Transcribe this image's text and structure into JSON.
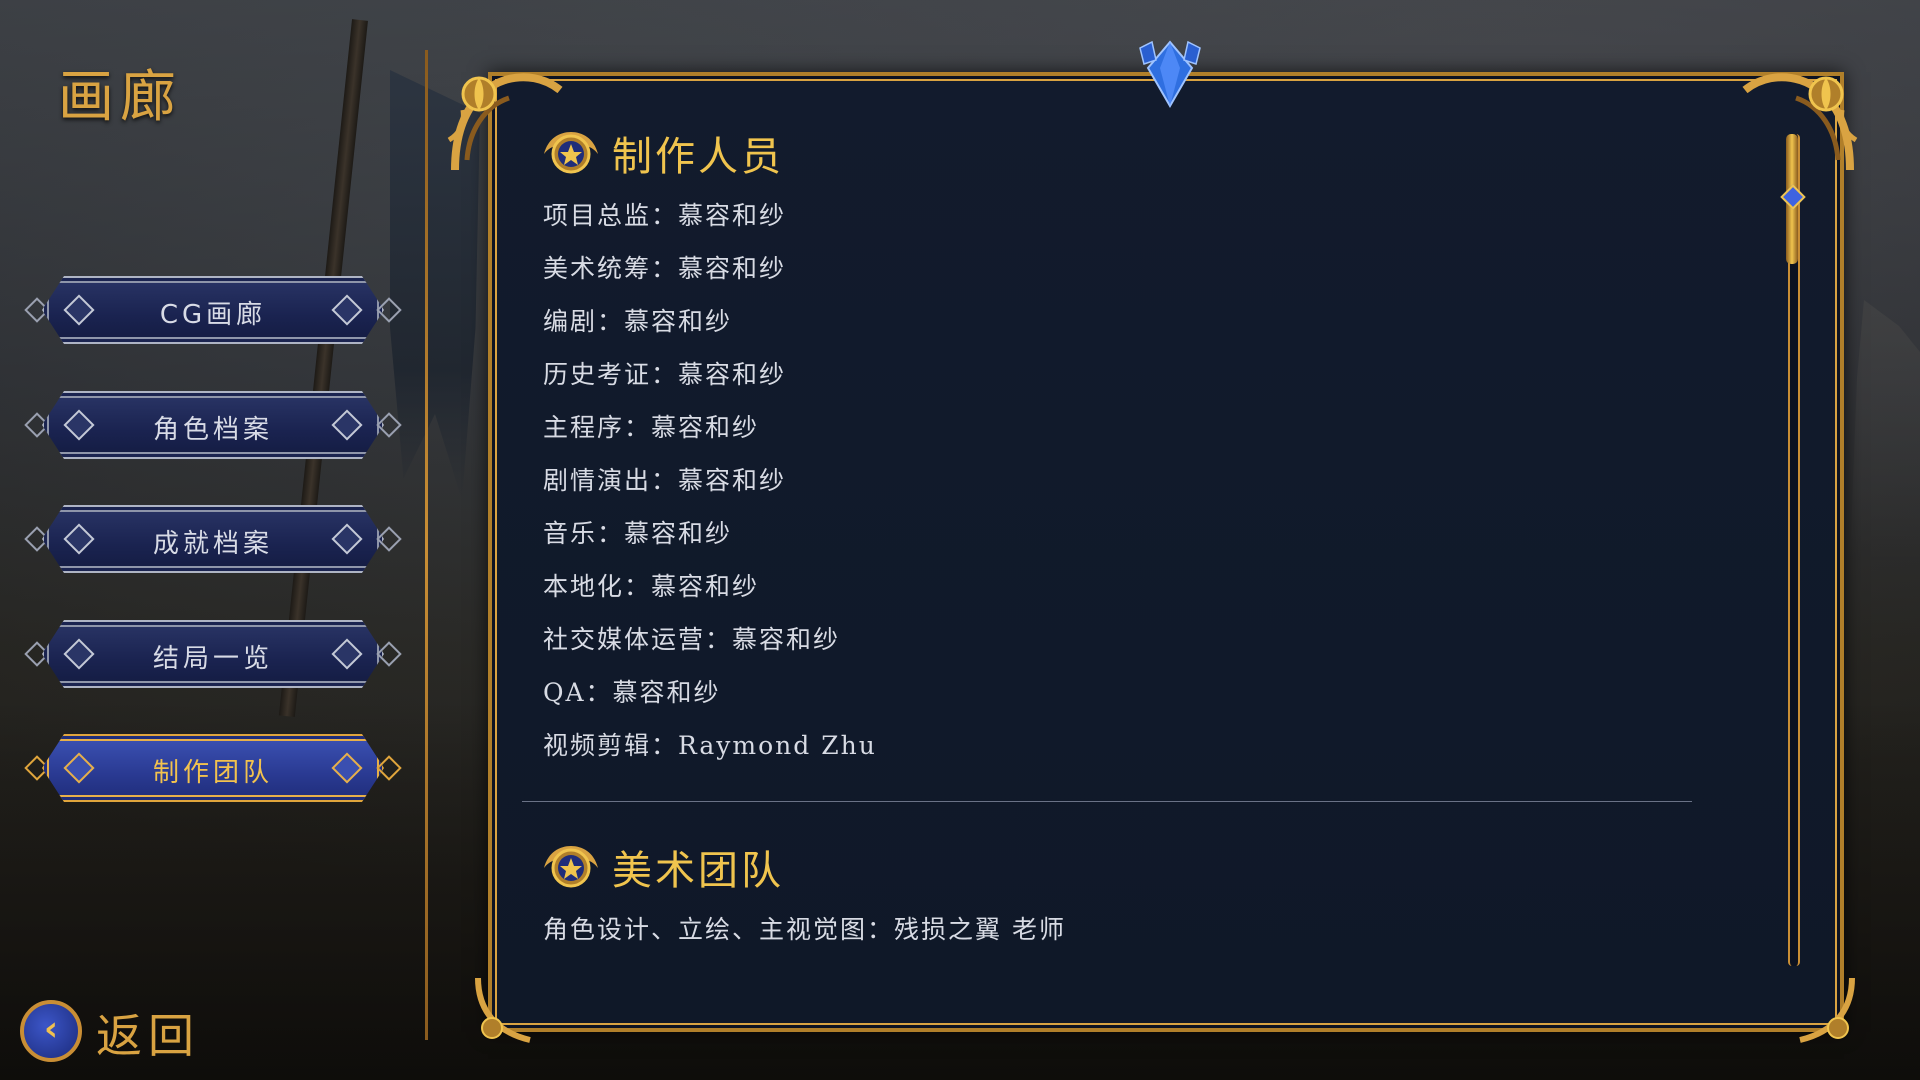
{
  "sidebar": {
    "title": "画廊",
    "items": [
      {
        "label": "CG画廊"
      },
      {
        "label": "角色档案"
      },
      {
        "label": "成就档案"
      },
      {
        "label": "结局一览"
      },
      {
        "label": "制作团队"
      }
    ],
    "active_index": 4,
    "back_label": "返回",
    "back_icon": "chevron-left-icon"
  },
  "panel": {
    "sections": [
      {
        "title": "制作人员",
        "icon": "star-emblem-icon",
        "lines": [
          "项目总监：慕容和纱",
          "美术统筹：慕容和纱",
          "编剧：慕容和纱",
          "历史考证：慕容和纱",
          "主程序：慕容和纱",
          "剧情演出：慕容和纱",
          "音乐：慕容和纱",
          "本地化：慕容和纱",
          "社交媒体运营：慕容和纱",
          "QA：慕容和纱",
          "视频剪辑：Raymond Zhu"
        ]
      },
      {
        "title": "美术团队",
        "icon": "star-emblem-icon",
        "lines": [
          "角色设计、立绘、主视觉图：残损之翼 老师"
        ]
      }
    ],
    "scroll_position": 0.0
  },
  "colors": {
    "gold": "#d9a342",
    "heading_gold": "#f0c44e",
    "panel_bg": "#121b2d",
    "button_blue": "#1a2350",
    "active_button_blue": "#2a3a92",
    "text": "#d8dbe4"
  }
}
